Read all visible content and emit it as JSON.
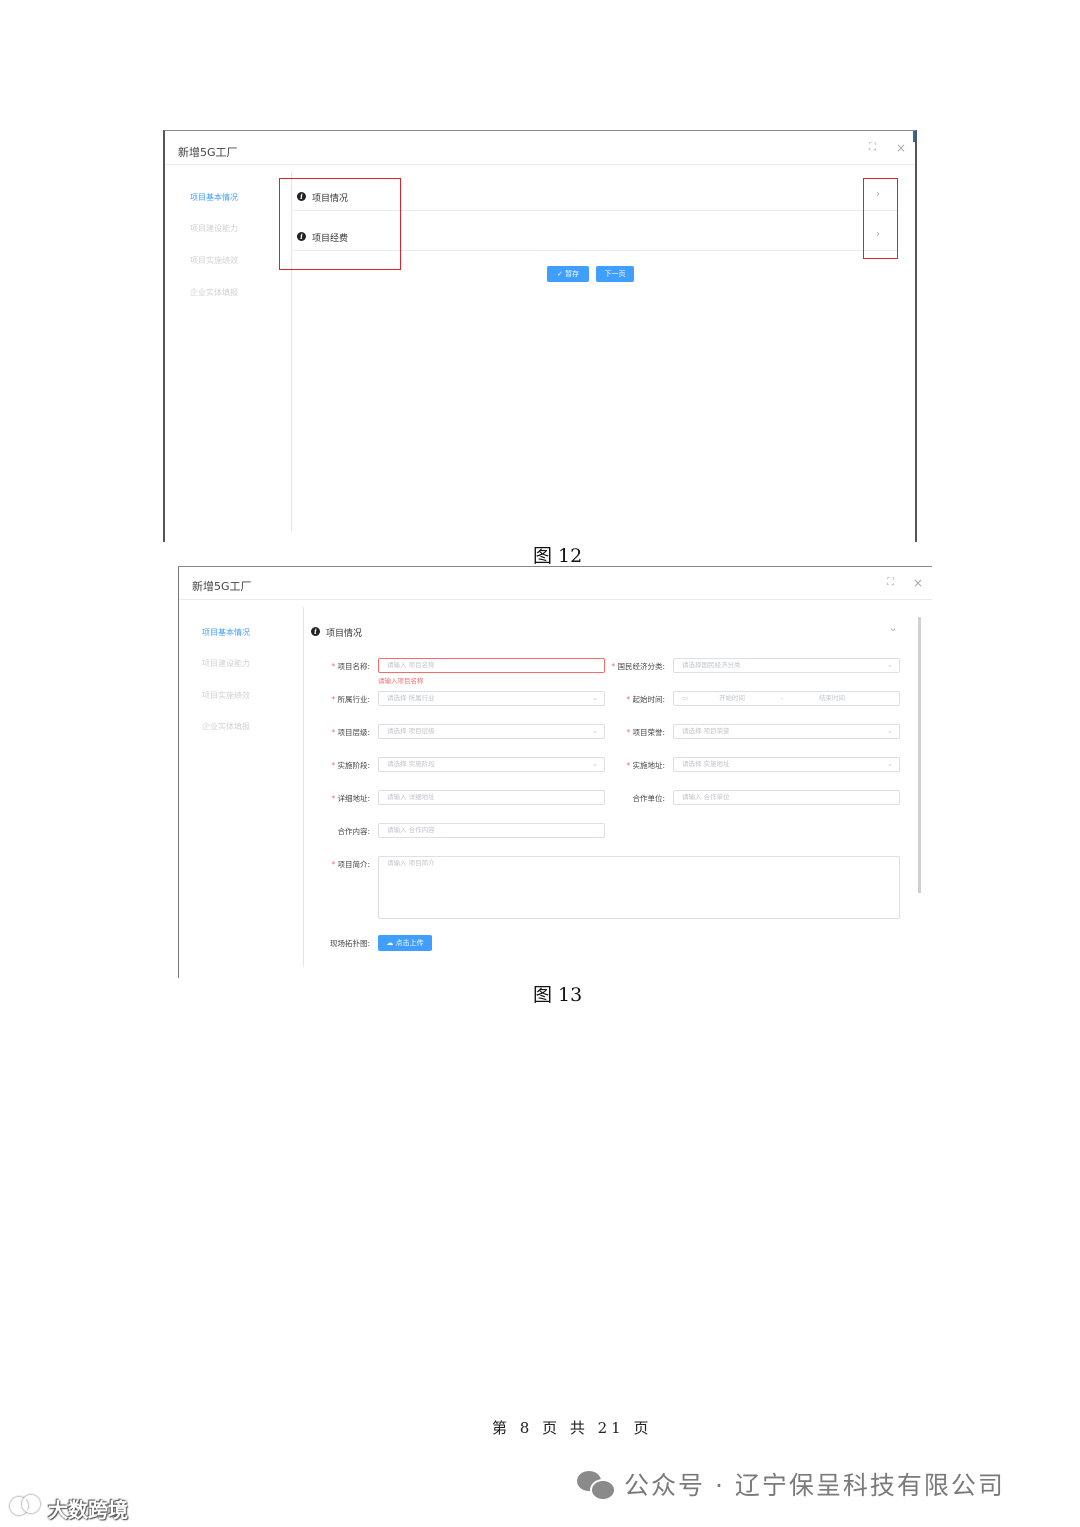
{
  "fig12": {
    "dialog_title": "新增5G工厂",
    "controls": {
      "maximize": "⛶",
      "close": "×"
    },
    "sidebar": [
      "项目基本情况",
      "项目建设能力",
      "项目实施绩效",
      "企业实体填报"
    ],
    "sections": [
      "项目情况",
      "项目经费"
    ],
    "chevron": "›",
    "buttons": {
      "save": "✓ 暂存",
      "next": "下一页"
    },
    "caption": "图 12"
  },
  "fig13": {
    "dialog_title": "新增5G工厂",
    "controls": {
      "maximize": "⛶",
      "close": "×"
    },
    "sidebar": [
      "项目基本情况",
      "项目建设能力",
      "项目实施绩效",
      "企业实体填报"
    ],
    "section": "项目情况",
    "section_toggle": "⌄",
    "fields": {
      "name": {
        "label": "项目名称:",
        "placeholder": "请输入 项目名称",
        "error": "请输入项目名称"
      },
      "econ": {
        "label": "国民经济分类:",
        "placeholder": "请选择国民经济分类"
      },
      "industry": {
        "label": "所属行业:",
        "placeholder": "请选择 所属行业"
      },
      "time": {
        "label": "起始时间:",
        "start": "开始时间",
        "sep": "-",
        "end": "结束时间"
      },
      "level": {
        "label": "项目层级:",
        "placeholder": "请选择 项目层级"
      },
      "funding": {
        "label": "项目荣誉:",
        "placeholder": "请选择 项目荣誉"
      },
      "stage": {
        "label": "实施阶段:",
        "placeholder": "请选择 实施阶段"
      },
      "place": {
        "label": "实施地址:",
        "placeholder": "请选择 实施地址"
      },
      "address": {
        "label": "详细地址:",
        "placeholder": "请输入 详细地址"
      },
      "partner": {
        "label": "合作单位:",
        "placeholder": "请输入 合作单位"
      },
      "coop": {
        "label": "合作内容:",
        "placeholder": "请输入 合作内容"
      },
      "intro": {
        "label": "项目简介:",
        "placeholder": "请输入 项目简介"
      },
      "topology": {
        "label": "现场拓扑图:",
        "upload": "☁ 点击上传"
      }
    },
    "required_mark": "*",
    "dropdown_icon": "⌄",
    "calendar_icon": "▭",
    "caption": "图 13"
  },
  "footer": "第 8 页 共 21 页",
  "watermark_right": "公众号 · 辽宁保呈科技有限公司",
  "watermark_left": "大数跨境"
}
